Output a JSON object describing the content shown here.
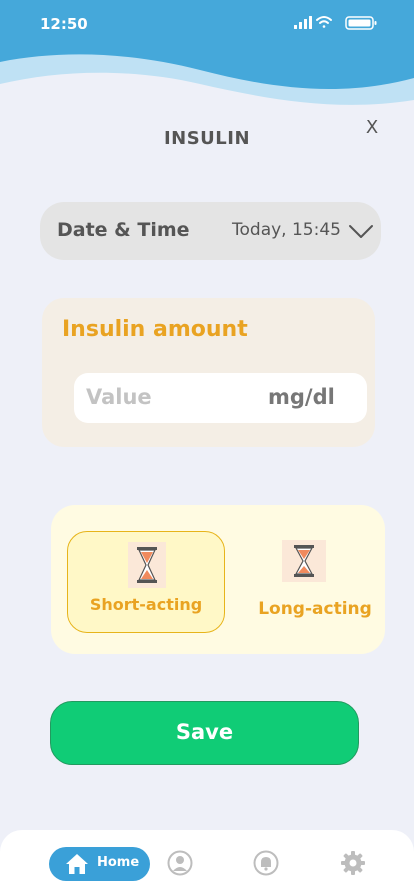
{
  "status_bar": {
    "time": "12:50",
    "icons": [
      "signal-icon",
      "wifi-icon",
      "battery-icon"
    ]
  },
  "header": {
    "title": "INSULIN",
    "close_label": "X"
  },
  "datetime": {
    "label": "Date & Time",
    "value": "Today, 15:45",
    "icon": "chevron-down-icon"
  },
  "amount": {
    "title": "Insulin amount",
    "placeholder": "Value",
    "unit": "mg/dl"
  },
  "insulin_type": {
    "options": [
      {
        "label": "Short-acting",
        "icon": "hourglass-icon",
        "selected": true
      },
      {
        "label": "Long-acting",
        "icon": "hourglass-icon",
        "selected": false
      }
    ]
  },
  "save_label": "Save",
  "tabbar": {
    "home_label": "Home",
    "icons": [
      "home-icon",
      "profile-icon",
      "bell-icon",
      "gear-icon"
    ]
  },
  "colors": {
    "wave": "#45a8da",
    "wave_light": "#bfe1f4",
    "accent_orange": "#e9a322",
    "save_green": "#10cc76",
    "home_pill": "#3aa0d8"
  }
}
